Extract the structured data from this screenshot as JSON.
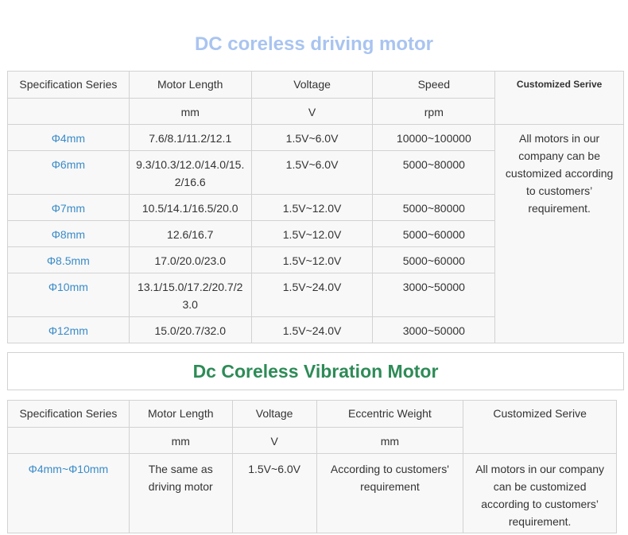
{
  "section1": {
    "title": "DC coreless driving motor",
    "headers": {
      "series": "Specification Series",
      "length": "Motor Length",
      "voltage": "Voltage",
      "speed": "Speed",
      "custom": "Customized Serive"
    },
    "units": {
      "length": "mm",
      "voltage": "V",
      "speed": "rpm"
    },
    "custom_text": "All motors in our company can be customized according to customers’ requirement.",
    "rows": [
      {
        "series": "Φ4mm",
        "length": "7.6/8.1/11.2/12.1",
        "voltage": "1.5V~6.0V",
        "speed": "10000~100000"
      },
      {
        "series": "Φ6mm",
        "length": "9.3/10.3/12.0/14.0/15.2/16.6",
        "voltage": "1.5V~6.0V",
        "speed": "5000~80000"
      },
      {
        "series": "Φ7mm",
        "length": "10.5/14.1/16.5/20.0",
        "voltage": "1.5V~12.0V",
        "speed": "5000~80000"
      },
      {
        "series": "Φ8mm",
        "length": "12.6/16.7",
        "voltage": "1.5V~12.0V",
        "speed": "5000~60000"
      },
      {
        "series": "Φ8.5mm",
        "length": "17.0/20.0/23.0",
        "voltage": "1.5V~12.0V",
        "speed": "5000~60000"
      },
      {
        "series": "Φ10mm",
        "length": "13.1/15.0/17.2/20.7/23.0",
        "voltage": "1.5V~24.0V",
        "speed": "3000~50000"
      },
      {
        "series": "Φ12mm",
        "length": "15.0/20.7/32.0",
        "voltage": "1.5V~24.0V",
        "speed": "3000~50000"
      }
    ]
  },
  "section2": {
    "title": "Dc Coreless Vibration Motor",
    "headers": {
      "series": "Specification Series",
      "length": "Motor Length",
      "voltage": "Voltage",
      "weight": "Eccentric Weight",
      "custom": "Customized Serive"
    },
    "units": {
      "length": "mm",
      "voltage": "V",
      "weight": "mm"
    },
    "row": {
      "series": "Φ4mm~Φ10mm",
      "length": "The same as driving motor",
      "voltage": "1.5V~6.0V",
      "weight": "According to customers' requirement",
      "custom": "All motors in our company can be customized according to customers’ requirement."
    }
  }
}
